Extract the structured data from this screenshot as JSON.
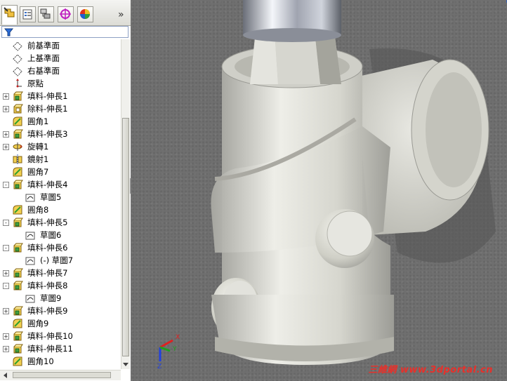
{
  "panel": {
    "tabs": [
      {
        "icon": "feature-manager-icon",
        "active": true
      },
      {
        "icon": "property-manager-icon",
        "active": false
      },
      {
        "icon": "configuration-manager-icon",
        "active": false
      },
      {
        "icon": "dimxpert-manager-icon",
        "active": false
      },
      {
        "icon": "display-manager-icon",
        "active": false
      }
    ],
    "more_label": "»",
    "filter_icon": "filter-icon"
  },
  "tree": [
    {
      "label": "前基準面",
      "icon": "plane-icon",
      "expander": "",
      "indent": 0
    },
    {
      "label": "上基準面",
      "icon": "plane-icon",
      "expander": "",
      "indent": 0
    },
    {
      "label": "右基準面",
      "icon": "plane-icon",
      "expander": "",
      "indent": 0
    },
    {
      "label": "原點",
      "icon": "origin-icon",
      "expander": "",
      "indent": 0
    },
    {
      "label": "填料-伸長1",
      "icon": "boss-extrude-icon",
      "expander": "+",
      "indent": 0
    },
    {
      "label": "除料-伸長1",
      "icon": "cut-extrude-icon",
      "expander": "+",
      "indent": 0
    },
    {
      "label": "圓角1",
      "icon": "fillet-icon",
      "expander": "",
      "indent": 0
    },
    {
      "label": "填料-伸長3",
      "icon": "boss-extrude-icon",
      "expander": "+",
      "indent": 0
    },
    {
      "label": "旋轉1",
      "icon": "revolve-icon",
      "expander": "+",
      "indent": 0
    },
    {
      "label": "鏡射1",
      "icon": "mirror-icon",
      "expander": "",
      "indent": 0
    },
    {
      "label": "圓角7",
      "icon": "fillet-icon",
      "expander": "",
      "indent": 0
    },
    {
      "label": "填料-伸長4",
      "icon": "boss-extrude-icon",
      "expander": "-",
      "indent": 0
    },
    {
      "label": "草圖5",
      "icon": "sketch-icon",
      "expander": "",
      "indent": 1
    },
    {
      "label": "圓角8",
      "icon": "fillet-icon",
      "expander": "",
      "indent": 0
    },
    {
      "label": "填料-伸長5",
      "icon": "boss-extrude-icon",
      "expander": "-",
      "indent": 0
    },
    {
      "label": "草圖6",
      "icon": "sketch-icon",
      "expander": "",
      "indent": 1
    },
    {
      "label": "填料-伸長6",
      "icon": "boss-extrude-icon",
      "expander": "-",
      "indent": 0
    },
    {
      "label": "(-) 草圖7",
      "icon": "sketch-icon",
      "expander": "",
      "indent": 1
    },
    {
      "label": "填料-伸長7",
      "icon": "boss-extrude-icon",
      "expander": "+",
      "indent": 0
    },
    {
      "label": "填料-伸長8",
      "icon": "boss-extrude-icon",
      "expander": "-",
      "indent": 0
    },
    {
      "label": "草圖9",
      "icon": "sketch-icon",
      "expander": "",
      "indent": 1
    },
    {
      "label": "填料-伸長9",
      "icon": "boss-extrude-icon",
      "expander": "+",
      "indent": 0
    },
    {
      "label": "圓角9",
      "icon": "fillet-icon",
      "expander": "",
      "indent": 0
    },
    {
      "label": "填料-伸長10",
      "icon": "boss-extrude-icon",
      "expander": "+",
      "indent": 0
    },
    {
      "label": "填料-伸長11",
      "icon": "boss-extrude-icon",
      "expander": "+",
      "indent": 0
    },
    {
      "label": "圓角10",
      "icon": "fillet-icon",
      "expander": "",
      "indent": 0
    }
  ],
  "viewport": {
    "triad_labels": {
      "x": "X",
      "y": "Y",
      "z": "Z"
    },
    "watermark": "三維網 www.3dportal.cn"
  },
  "colors": {
    "panel_bg": "#ffffff",
    "viewport_bg": "#6f6f6f",
    "part_color": "#d8d8d0",
    "watermark": "#e8302a"
  }
}
